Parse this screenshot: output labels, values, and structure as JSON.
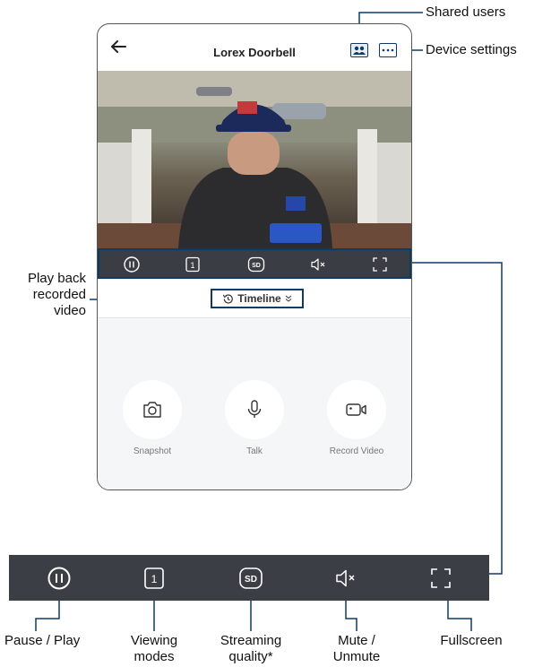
{
  "app": {
    "title": "Lorex Doorbell"
  },
  "icons": {
    "back": "back-arrow-icon",
    "shared_users": "users-icon",
    "device_settings": "more-dots-icon",
    "pause": "pause-icon",
    "viewing_modes": "single-view-icon",
    "streaming_quality": "sd-icon",
    "mute": "speaker-mute-icon",
    "fullscreen": "fullscreen-icon",
    "timeline": "history-clock-icon"
  },
  "controls": {
    "viewing_mode_value": "1",
    "streaming_quality_value": "SD"
  },
  "timeline": {
    "label": "Timeline"
  },
  "actions": [
    {
      "label": "Snapshot"
    },
    {
      "label": "Talk"
    },
    {
      "label": "Record Video"
    }
  ],
  "callouts": {
    "shared_users": "Shared users",
    "device_settings": "Device settings",
    "play_back_1": "Play back",
    "play_back_2": "recorded",
    "play_back_3": "video",
    "pause_play": "Pause / Play",
    "viewing_modes_1": "Viewing",
    "viewing_modes_2": "modes",
    "streaming_quality_1": "Streaming",
    "streaming_quality_2": "quality*",
    "mute_1": "Mute /",
    "mute_2": "Unmute",
    "fullscreen": "Fullscreen"
  },
  "colors": {
    "accent_outline": "#0e3a66",
    "control_bar": "#3b3f45",
    "action_bg": "#f5f6f8"
  }
}
